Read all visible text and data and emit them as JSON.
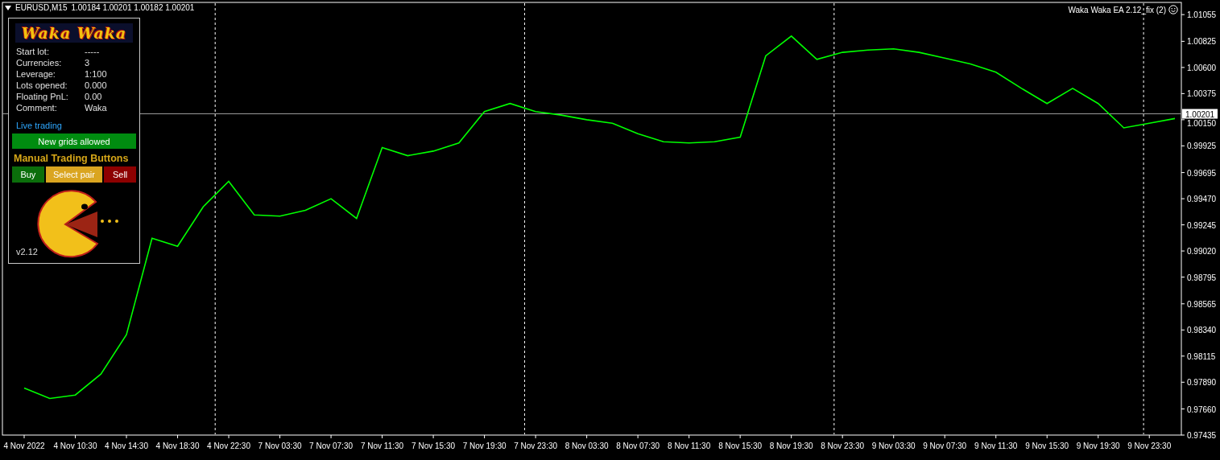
{
  "chart_header": {
    "symbol": "EURUSD,M15",
    "quote": "1.00184 1.00201 1.00182 1.00201"
  },
  "ea_label": "Waka Waka EA 2.12_fix (2)",
  "panel": {
    "title": "Waka Waka",
    "stats": [
      {
        "label": "Start lot:",
        "value": "-----"
      },
      {
        "label": "Currencies:",
        "value": "3"
      },
      {
        "label": "Leverage:",
        "value": "1:100"
      },
      {
        "label": "Lots opened:",
        "value": "0.000"
      },
      {
        "label": "Floating PnL:",
        "value": "0.00"
      },
      {
        "label": "Comment:",
        "value": "Waka"
      }
    ],
    "status": "Live trading",
    "grid_button": "New grids allowed",
    "section_title": "Manual Trading Buttons",
    "buttons": [
      {
        "label": "Buy",
        "kind": "buy"
      },
      {
        "label": "Select pair",
        "kind": "select"
      },
      {
        "label": "Sell",
        "kind": "sell"
      }
    ],
    "version": "v2.12"
  },
  "chart": {
    "chart_data": {
      "type": "line",
      "ref_lines": [
        {
          "axis": "y",
          "value": 1.00201,
          "label": "1.00201"
        }
      ],
      "categories": [
        "4 Nov 2022",
        null,
        "4 Nov 10:30",
        null,
        "4 Nov 14:30",
        null,
        "4 Nov 18:30",
        null,
        "4 Nov 22:30",
        null,
        "7 Nov 03:30",
        null,
        "7 Nov 07:30",
        null,
        "7 Nov 11:30",
        null,
        "7 Nov 15:30",
        null,
        "7 Nov 19:30",
        null,
        "7 Nov 23:30",
        null,
        "8 Nov 03:30",
        null,
        "8 Nov 07:30",
        null,
        "8 Nov 11:30",
        null,
        "8 Nov 15:30",
        null,
        "8 Nov 19:30",
        null,
        "8 Nov 23:30",
        null,
        "9 Nov 03:30",
        null,
        "9 Nov 07:30",
        null,
        "9 Nov 11:30",
        null,
        "9 Nov 15:30",
        null,
        "9 Nov 19:30",
        null,
        "9 Nov 23:30",
        null
      ],
      "series": [
        {
          "color": "#00ff00",
          "values": [
            0.9784,
            0.9775,
            0.9778,
            0.9796,
            0.983,
            0.9913,
            0.9906,
            0.994,
            0.9962,
            0.9933,
            0.9932,
            0.9937,
            0.9947,
            0.993,
            0.9991,
            0.9984,
            0.9988,
            0.9995,
            1.0022,
            1.0029,
            1.0022,
            1.0019,
            1.0015,
            1.0012,
            1.0003,
            0.9996,
            0.9995,
            0.9996,
            1.0,
            1.007,
            1.0087,
            1.0067,
            1.0073,
            1.0075,
            1.0076,
            1.0073,
            1.0068,
            1.0063,
            1.0056,
            1.0042,
            1.0029,
            1.0042,
            1.0029,
            1.0008,
            1.0012,
            1.0016
          ]
        }
      ],
      "ylim": [
        0.97435,
        1.0116
      ],
      "grid": true,
      "yticks": [
        {
          "value": 1.01055,
          "label": "1.01055"
        },
        {
          "value": 1.00825,
          "label": "1.00825"
        },
        {
          "value": 1.006,
          "label": "1.00600"
        },
        {
          "value": 1.00375,
          "label": "1.00375"
        },
        {
          "value": 1.0015,
          "label": "1.00150"
        },
        {
          "value": 0.99925,
          "label": "0.99925"
        },
        {
          "value": 0.99695,
          "label": "0.99695"
        },
        {
          "value": 0.9947,
          "label": "0.99470"
        },
        {
          "value": 0.99245,
          "label": "0.99245"
        },
        {
          "value": 0.9902,
          "label": "0.99020"
        },
        {
          "value": 0.98795,
          "label": "0.98795"
        },
        {
          "value": 0.98565,
          "label": "0.98565"
        },
        {
          "value": 0.9834,
          "label": "0.98340"
        },
        {
          "value": 0.98115,
          "label": "0.98115"
        },
        {
          "value": 0.9789,
          "label": "0.97890"
        },
        {
          "value": 0.9766,
          "label": "0.97660"
        },
        {
          "value": 0.97435,
          "label": "0.97435"
        }
      ]
    }
  }
}
